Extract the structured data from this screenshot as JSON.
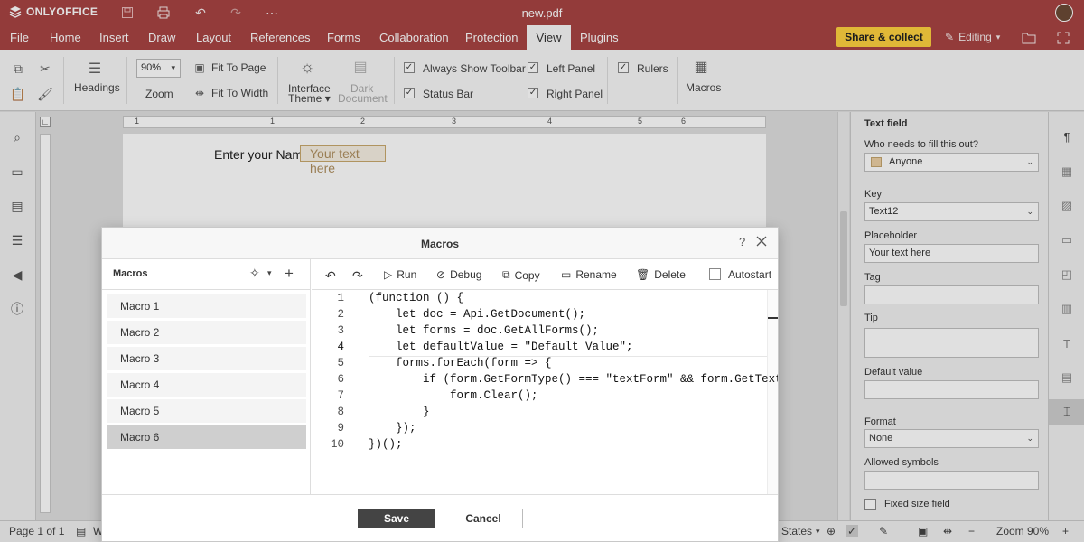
{
  "app": {
    "logo": "ONLYOFFICE",
    "doc_title": "new.pdf"
  },
  "menu": {
    "tabs": [
      "File",
      "Home",
      "Insert",
      "Draw",
      "Layout",
      "References",
      "Forms",
      "Collaboration",
      "Protection",
      "View",
      "Plugins"
    ],
    "share": "Share & collect",
    "editing": "Editing"
  },
  "ribbon": {
    "headings": "Headings",
    "zoom_value": "90%",
    "zoom_label": "Zoom",
    "fit_page": "Fit To Page",
    "fit_width": "Fit To Width",
    "interface_theme_1": "Interface",
    "interface_theme_2": "Theme",
    "dark_doc_1": "Dark",
    "dark_doc_2": "Document",
    "always_toolbar": "Always Show Toolbar",
    "status_bar": "Status Bar",
    "left_panel": "Left Panel",
    "right_panel": "Right Panel",
    "rulers": "Rulers",
    "macros": "Macros",
    "check": "✓"
  },
  "document": {
    "field_label": "Enter your Name",
    "field_placeholder": "Your text here"
  },
  "dialog": {
    "title": "Macros",
    "help": "?",
    "list_title": "Macros",
    "macros": [
      "Macro 1",
      "Macro 2",
      "Macro 3",
      "Macro 4",
      "Macro 5",
      "Macro 6"
    ],
    "toolbar": {
      "run": "Run",
      "debug": "Debug",
      "copy": "Copy",
      "rename": "Rename",
      "delete": "Delete",
      "autostart": "Autostart"
    },
    "line_numbers": [
      "1",
      "2",
      "3",
      "4",
      "5",
      "6",
      "7",
      "8",
      "9",
      "10"
    ],
    "code": [
      "(function () {",
      "    let doc = Api.GetDocument();",
      "    let forms = doc.GetAllForms();",
      "    let defaultValue = \"Default Value\";",
      "    forms.forEach(form => {",
      "        if (form.GetFormType() === \"textForm\" && form.GetText()",
      "            form.Clear();",
      "        }",
      "    });",
      "})();"
    ],
    "save": "Save",
    "cancel": "Cancel"
  },
  "right_panel": {
    "title": "Text field",
    "who_label": "Who needs to fill this out?",
    "who_value": "Anyone",
    "key_label": "Key",
    "key_value": "Text12",
    "placeholder_label": "Placeholder",
    "placeholder_value": "Your text here",
    "tag_label": "Tag",
    "tip_label": "Tip",
    "default_label": "Default value",
    "format_label": "Format",
    "format_value": "None",
    "allowed_label": "Allowed symbols",
    "fixed_label": "Fixed size field"
  },
  "status": {
    "page": "Page 1 of 1",
    "word_count": "W",
    "states": "States",
    "zoom": "Zoom 90%"
  },
  "ruler_numbers": [
    "1",
    "1",
    "2",
    "3",
    "4",
    "5",
    "6"
  ]
}
